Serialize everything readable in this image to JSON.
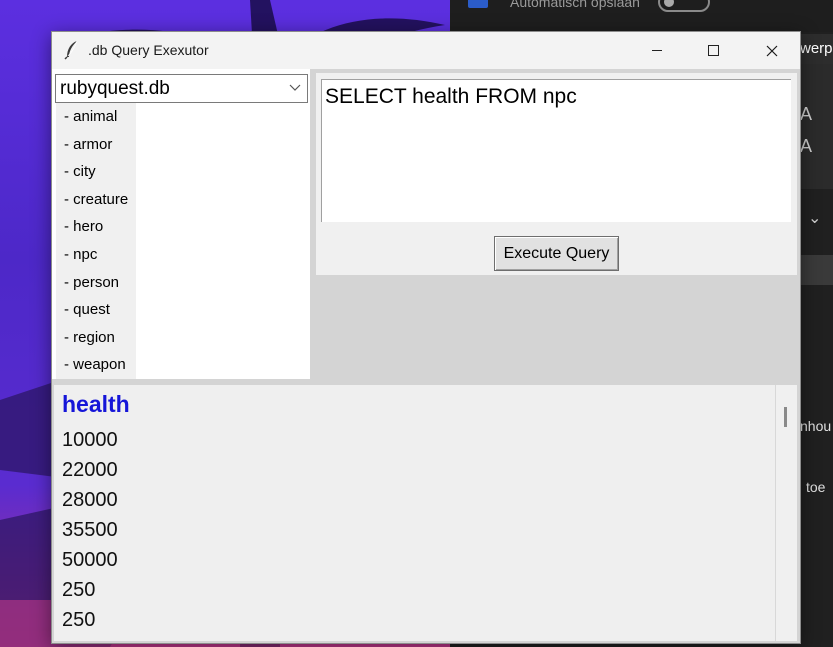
{
  "window": {
    "title": ".db Query Exexutor",
    "controls": {
      "minimize": "minimize",
      "maximize": "maximize",
      "close": "close"
    }
  },
  "database": {
    "selected": "rubyquest.db",
    "tables": [
      "- animal",
      "- armor",
      "- city",
      "- creature",
      "- hero",
      "- npc",
      "- person",
      "- quest",
      "- region",
      "- weapon"
    ]
  },
  "query": {
    "text": "SELECT health FROM npc",
    "execute_label": "Execute Query"
  },
  "results": {
    "column": "health",
    "rows": [
      "10000",
      "22000",
      "28000",
      "35500",
      "50000",
      "250",
      "250"
    ]
  },
  "background": {
    "autosave": "Automatisch opslaan",
    "ribbon_tab": "werp",
    "side_text_1": "nhou",
    "side_text_2": "toe"
  },
  "colors": {
    "header_blue": "#1515d8",
    "wallpaper_purple": "#5a2fd0"
  }
}
